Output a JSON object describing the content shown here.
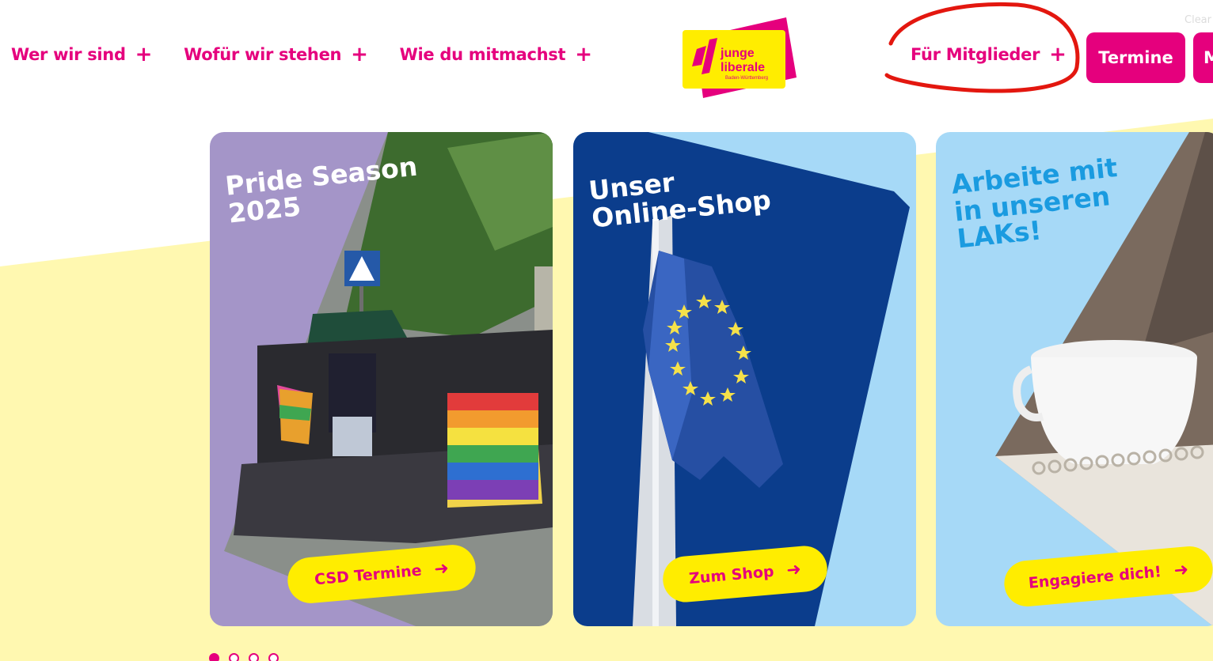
{
  "nav": {
    "items": [
      {
        "label": "Wer wir sind",
        "icon": "plus-icon"
      },
      {
        "label": "Wofür wir stehen",
        "icon": "plus-icon"
      },
      {
        "label": "Wie du mitmachst",
        "icon": "plus-icon"
      }
    ],
    "members": {
      "label": "Für Mitglieder",
      "icon": "plus-icon"
    },
    "termine_label": "Termine",
    "more_label": "M",
    "clear_label": "Clear"
  },
  "logo": {
    "line1": "junge",
    "line2": "liberale",
    "line3": "Baden-Württemberg"
  },
  "cards": [
    {
      "title": "Pride Season\n2025",
      "button": "CSD Termine"
    },
    {
      "title": "Unser\nOnline-Shop",
      "button": "Zum Shop"
    },
    {
      "title": "Arbeite mit\nin unseren\nLAKs!",
      "button": "Engagiere dich!"
    }
  ],
  "carousel": {
    "page_count": 4,
    "active_index": 0
  },
  "colors": {
    "brand_pink": "#e5007d",
    "brand_yellow": "#ffed00",
    "pale_yellow": "#fff8b0",
    "lavender": "#a495c8",
    "navy": "#0b3d8c",
    "light_blue": "#a6d9f7"
  }
}
